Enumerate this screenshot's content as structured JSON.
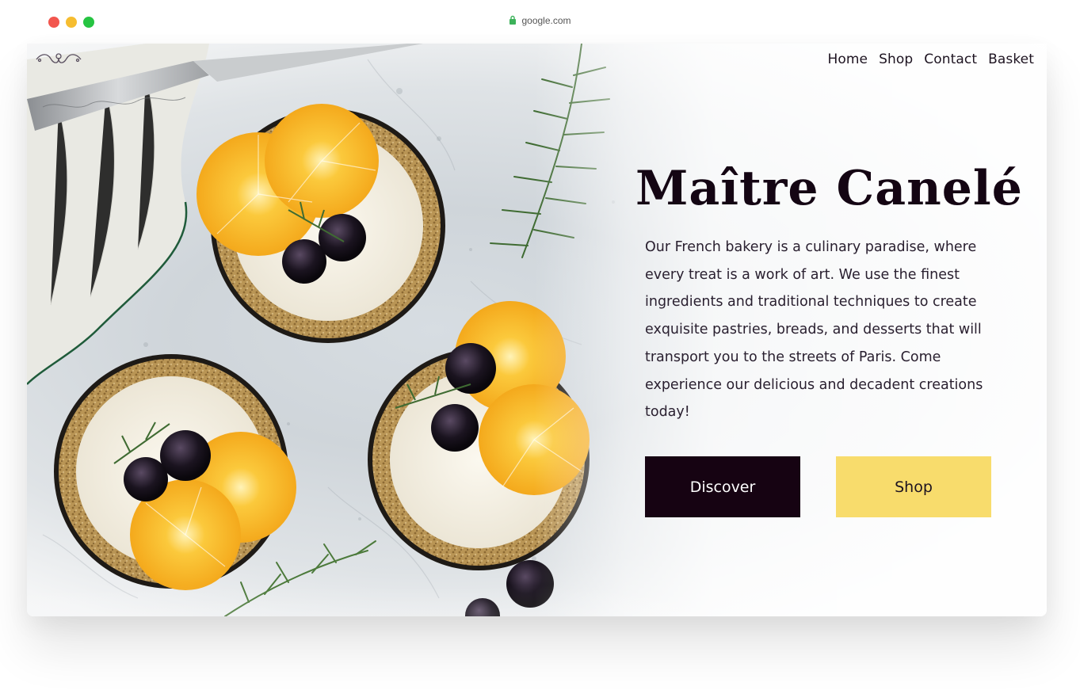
{
  "browser": {
    "url": "google.com"
  },
  "nav": {
    "items": [
      "Home",
      "Shop",
      "Contact",
      "Basket"
    ]
  },
  "hero": {
    "title": "Maître Canelé",
    "description": "Our French bakery is a culinary paradise, where every treat is a work of art. We use the finest ingredients and traditional techniques to create exquisite pastries, breads, and desserts that will transport you to the streets of Paris. Come experience our delicious and decadent creations today!",
    "buttons": {
      "discover": "Discover",
      "shop": "Shop"
    }
  },
  "colors": {
    "title": "#140513",
    "discover_bg": "#160312",
    "shop_bg": "#f8dc6c"
  },
  "icons": [
    "lock-icon",
    "logo-ornament-icon"
  ]
}
